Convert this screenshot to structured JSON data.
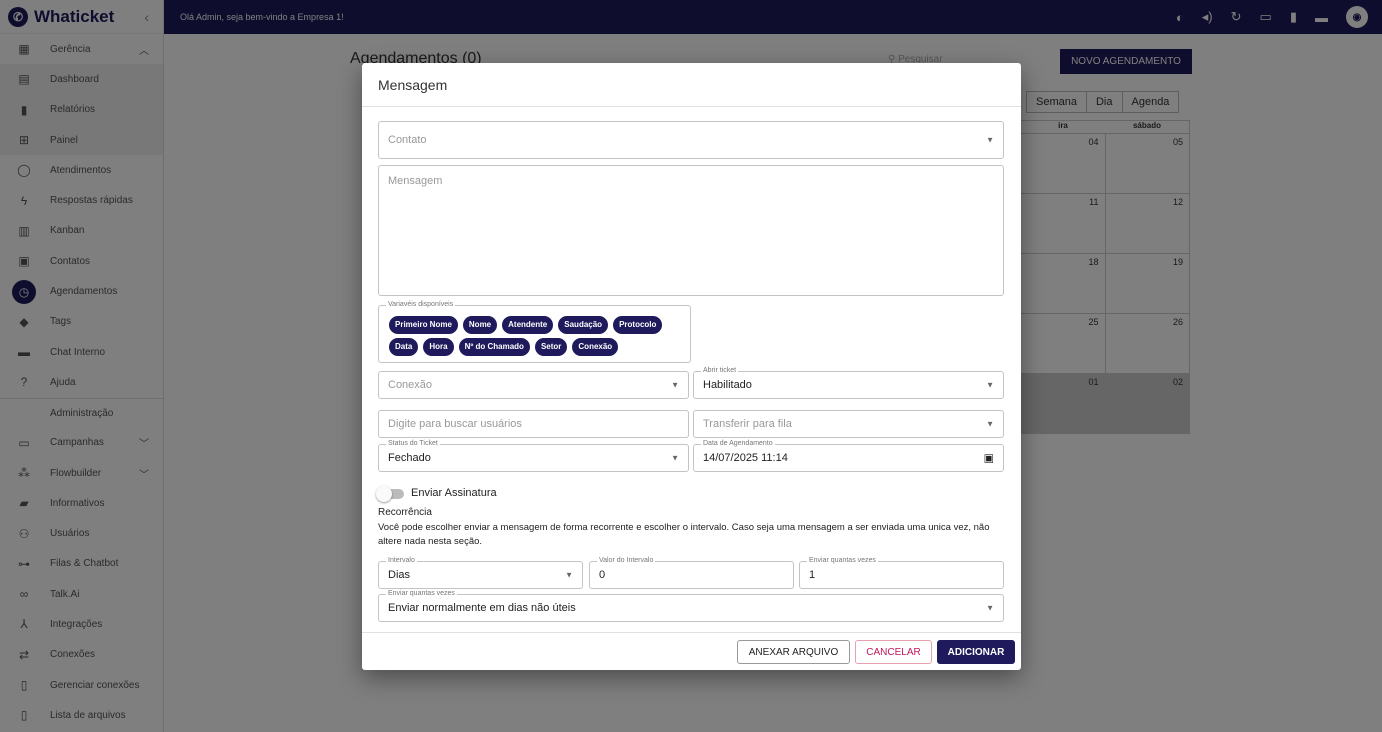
{
  "app": {
    "name": "Whaticket",
    "welcome": "Olá Admin, seja bem-vindo a Empresa 1!"
  },
  "sidebar": {
    "items": [
      {
        "label": "Gerência",
        "icon": "grid-icon"
      },
      {
        "label": "Dashboard",
        "icon": "dashboard-icon"
      },
      {
        "label": "Relatórios",
        "icon": "report-icon"
      },
      {
        "label": "Painel",
        "icon": "panel-icon"
      },
      {
        "label": "Atendimentos",
        "icon": "whatsapp-icon"
      },
      {
        "label": "Respostas rápidas",
        "icon": "flash-icon"
      },
      {
        "label": "Kanban",
        "icon": "kanban-icon"
      },
      {
        "label": "Contatos",
        "icon": "contacts-icon"
      },
      {
        "label": "Agendamentos",
        "icon": "clock-icon"
      },
      {
        "label": "Tags",
        "icon": "tag-icon"
      },
      {
        "label": "Chat Interno",
        "icon": "chat-icon"
      },
      {
        "label": "Ajuda",
        "icon": "help-icon"
      }
    ],
    "section_admin": "Administração",
    "admin_items": [
      {
        "label": "Campanhas",
        "icon": "calendar-icon"
      },
      {
        "label": "Flowbuilder",
        "icon": "flow-icon"
      },
      {
        "label": "Informativos",
        "icon": "announcement-icon"
      },
      {
        "label": "Usuários",
        "icon": "users-icon"
      },
      {
        "label": "Filas & Chatbot",
        "icon": "queue-icon"
      },
      {
        "label": "Talk.Ai",
        "icon": "infinity-icon"
      },
      {
        "label": "Integrações",
        "icon": "integration-icon"
      },
      {
        "label": "Conexões",
        "icon": "connections-icon"
      },
      {
        "label": "Gerenciar conexões",
        "icon": "manage-icon"
      },
      {
        "label": "Lista de arquivos",
        "icon": "file-icon"
      }
    ]
  },
  "background": {
    "title": "Agendamentos (0)",
    "search_placeholder": "Pesquisar",
    "new_button": "NOVO AGENDAMENTO",
    "views": [
      "Semana",
      "Dia",
      "Agenda"
    ],
    "cal_headers": [
      "ira",
      "sábado"
    ],
    "cal_rows": [
      [
        "04",
        "05"
      ],
      [
        "11",
        "12"
      ],
      [
        "18",
        "19"
      ],
      [
        "25",
        "26"
      ],
      [
        "01",
        "02"
      ]
    ]
  },
  "modal": {
    "title": "Mensagem",
    "contato_placeholder": "Contato",
    "mensagem_placeholder": "Mensagem",
    "variables_label": "Variavéis disponíveis",
    "variables": [
      "Primeiro Nome",
      "Nome",
      "Atendente",
      "Saudação",
      "Protocolo",
      "Data",
      "Hora",
      "Nº do Chamado",
      "Setor",
      "Conexão"
    ],
    "conexao_placeholder": "Conexão",
    "abrir_ticket_label": "Abrir ticket",
    "abrir_ticket_value": "Habilitado",
    "usuarios_placeholder": "Digite para buscar usuários",
    "fila_placeholder": "Transferir para fila",
    "status_label": "Status do Ticket",
    "status_value": "Fechado",
    "data_label": "Data de Agendamento",
    "data_value": "14/07/2025 11:14",
    "assinatura_label": "Enviar Assinatura",
    "recorrencia_title": "Recorrência",
    "recorrencia_desc": "Você pode escolher enviar a mensagem de forma recorrente e escolher o intervalo. Caso seja uma mensagem a ser enviada uma unica vez, não altere nada nesta seção.",
    "intervalo_label": "Intervalo",
    "intervalo_value": "Dias",
    "valor_label": "Valor do Intervalo",
    "valor_value": "0",
    "vezes_label": "Enviar quantas vezes",
    "vezes_value": "1",
    "dias_label": "Enviar quantas vezes",
    "dias_value": "Enviar normalmente em dias não úteis",
    "btn_attach": "ANEXAR ARQUIVO",
    "btn_cancel": "CANCELAR",
    "btn_add": "ADICIONAR"
  }
}
